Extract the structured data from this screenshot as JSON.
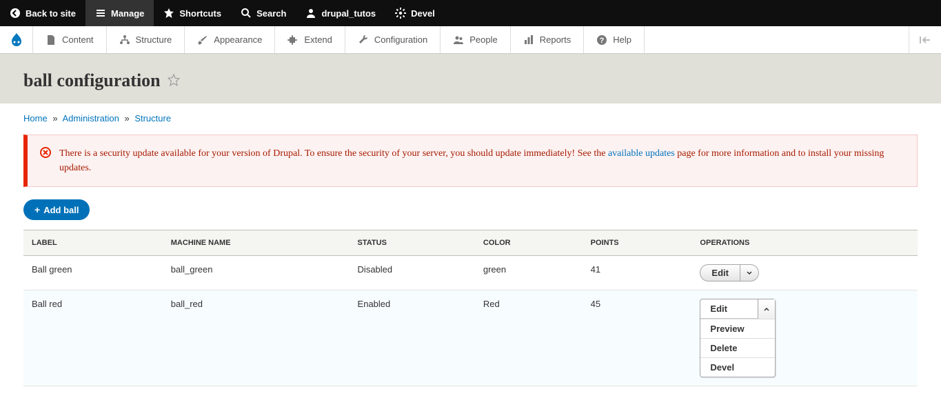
{
  "toolbar": {
    "back": "Back to site",
    "manage": "Manage",
    "shortcuts": "Shortcuts",
    "search": "Search",
    "user": "drupal_tutos",
    "devel": "Devel"
  },
  "adminMenu": {
    "content": "Content",
    "structure": "Structure",
    "appearance": "Appearance",
    "extend": "Extend",
    "configuration": "Configuration",
    "people": "People",
    "reports": "Reports",
    "help": "Help"
  },
  "page": {
    "title": "ball configuration"
  },
  "breadcrumb": {
    "home": "Home",
    "admin": "Administration",
    "structure": "Structure"
  },
  "alert": {
    "text1": "There is a security update available for your version of Drupal. To ensure the security of your server, you should update immediately! See the ",
    "link": "available updates",
    "text2": " page for more information and to install your missing updates."
  },
  "addButton": "Add ball",
  "table": {
    "headers": {
      "label": "Label",
      "machine": "Machine Name",
      "status": "Status",
      "color": "Color",
      "points": "Points",
      "operations": "Operations"
    },
    "rows": [
      {
        "label": "Ball green",
        "machine": "ball_green",
        "status": "Disabled",
        "color": "green",
        "points": "41"
      },
      {
        "label": "Ball red",
        "machine": "ball_red",
        "status": "Enabled",
        "color": "Red",
        "points": "45"
      }
    ]
  },
  "ops": {
    "edit": "Edit",
    "preview": "Preview",
    "delete": "Delete",
    "devel": "Devel"
  }
}
